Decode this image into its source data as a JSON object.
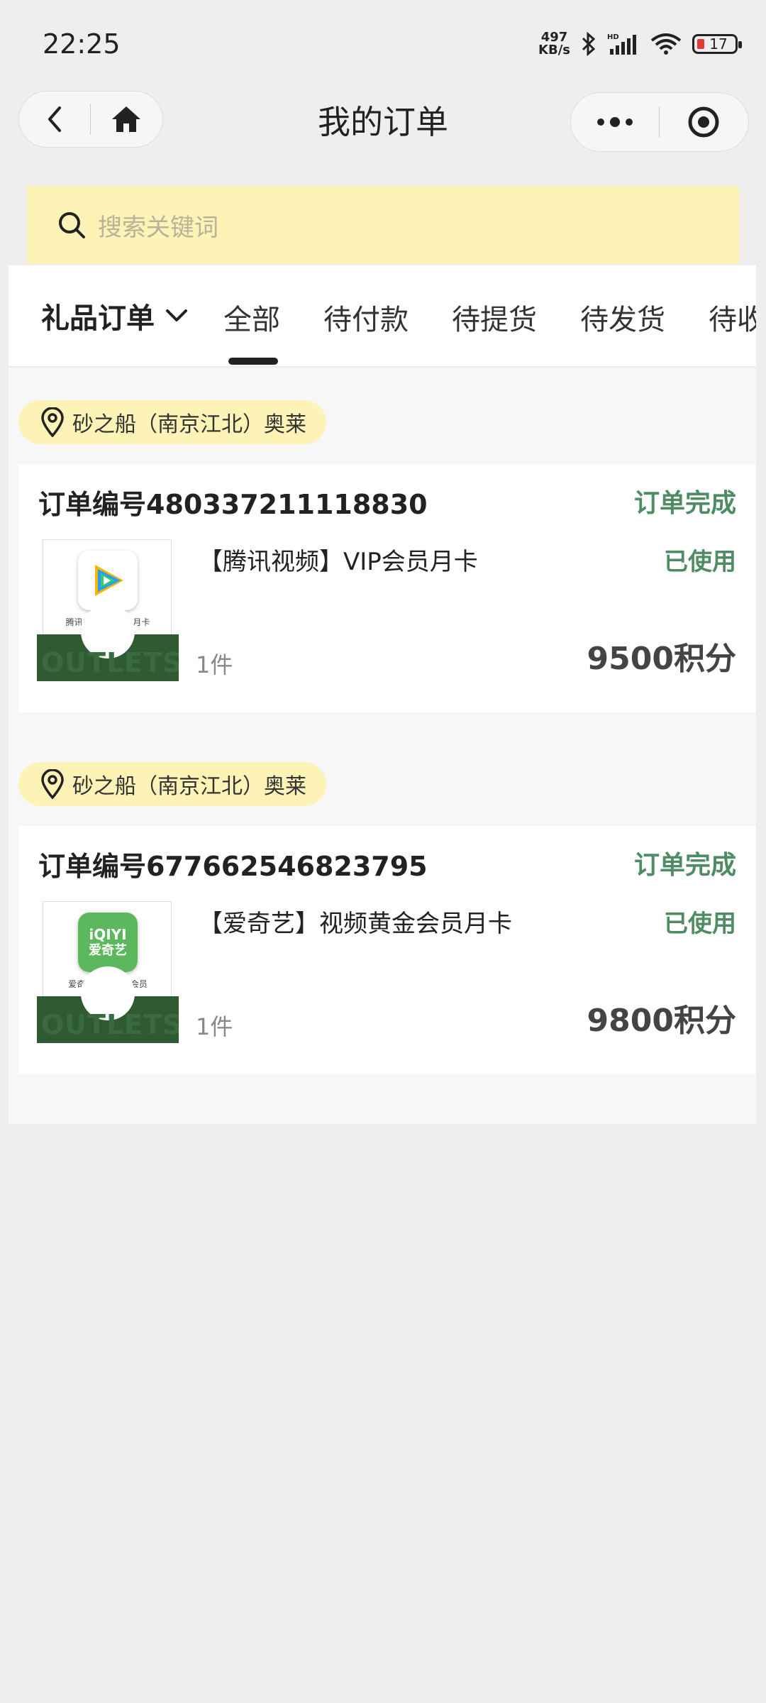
{
  "status_bar": {
    "time": "22:25",
    "net_speed_value": "497",
    "net_speed_unit": "KB/s",
    "battery": "17",
    "battery_color": "#e53935"
  },
  "nav": {
    "title": "我的订单",
    "back_icon": "chevron-left-icon",
    "home_icon": "home-icon",
    "more_icon": "more-dots-icon",
    "close_icon": "target-circle-icon"
  },
  "search": {
    "placeholder": "搜索关键词",
    "icon": "search-icon"
  },
  "tabs": {
    "gift_label": "礼品订单",
    "items": [
      "全部",
      "待付款",
      "待提货",
      "待发货",
      "待收货"
    ],
    "active_index": 0
  },
  "orders": [
    {
      "store": "砂之船（南京江北）奥莱",
      "order_no": "订单编号480337211118830",
      "status": "订单完成",
      "product": "【腾讯视频】VIP会员月卡",
      "product_thumb_caption": "腾讯视频 VIP会员月卡",
      "usage": "已使用",
      "qty": "1件",
      "price": "9500积分"
    },
    {
      "store": "砂之船（南京江北）奥莱",
      "order_no": "订单编号677662546823795",
      "status": "订单完成",
      "product": "【爱奇艺】视频黄金会员月卡",
      "product_thumb_caption": "爱奇艺 黄金月卡会员",
      "logo_text_top": "iQIYI",
      "logo_text_bottom": "爱奇艺",
      "usage": "已使用",
      "qty": "1件",
      "price": "9800积分"
    }
  ],
  "colors": {
    "accent_green": "#4f8c63",
    "search_bg": "#fdf3b6",
    "thumb_green": "#2e5b32"
  }
}
